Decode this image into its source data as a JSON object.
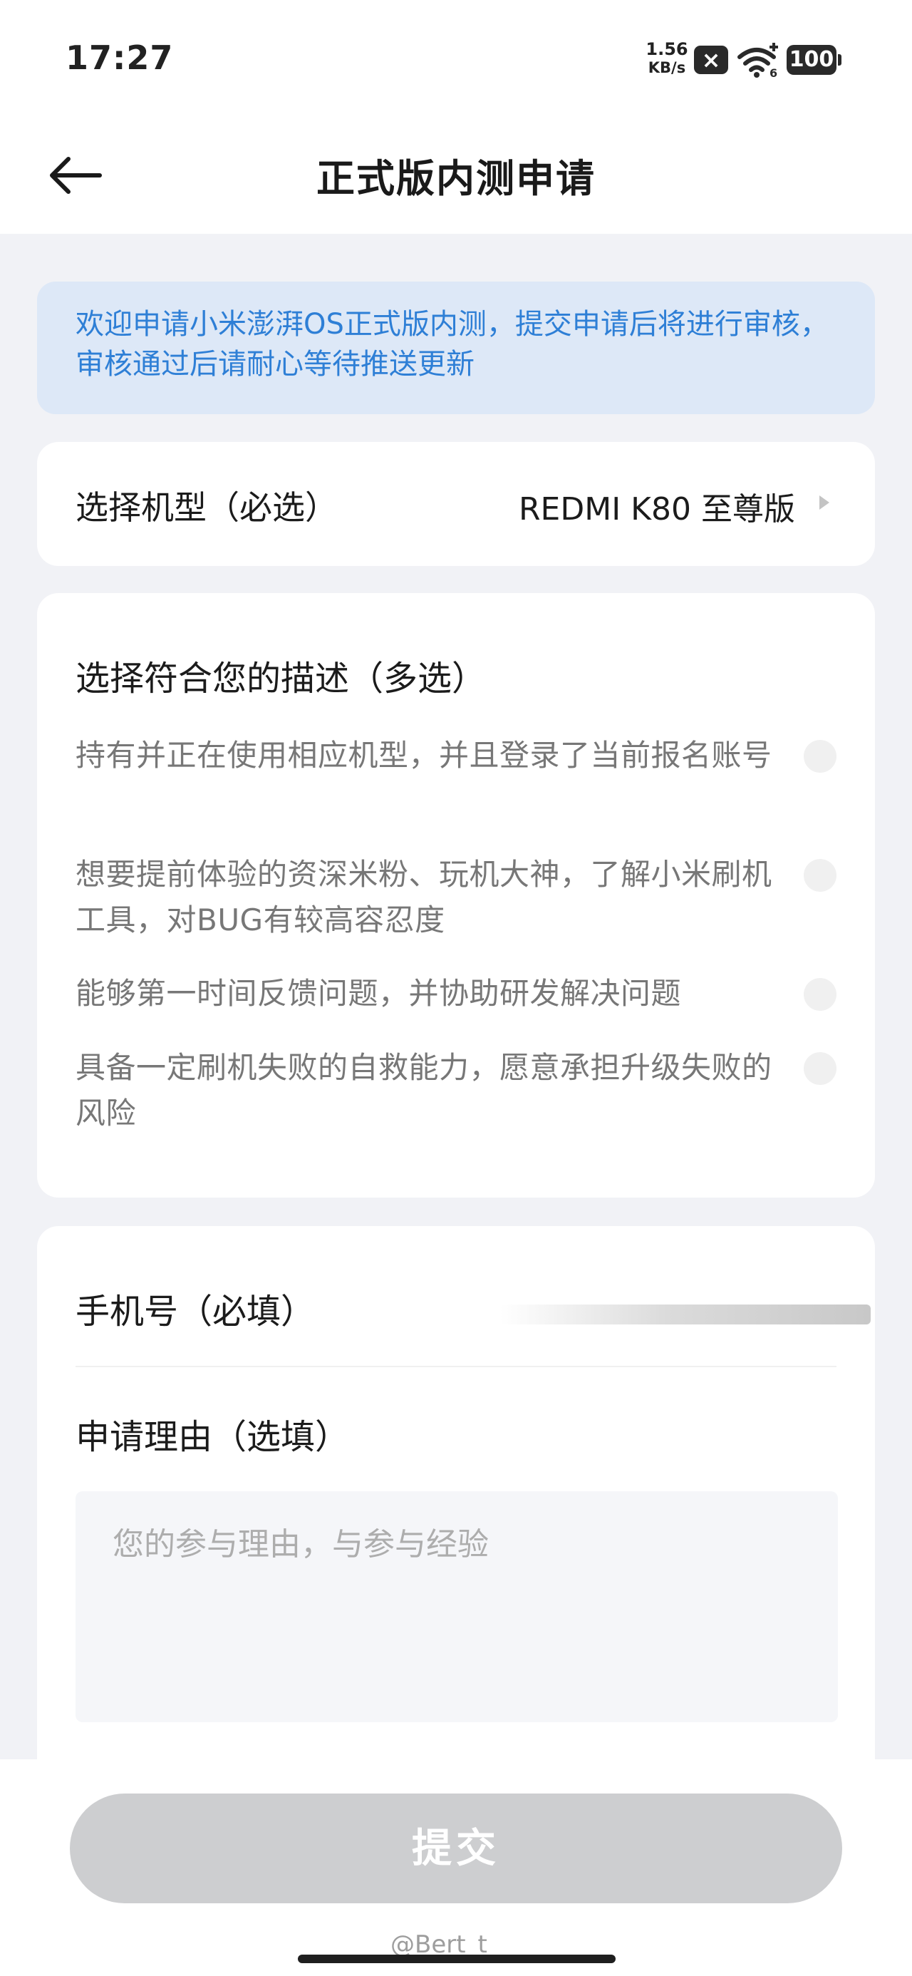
{
  "status_bar": {
    "time": "17:27",
    "net_speed_value": "1.56",
    "net_speed_unit": "KB/s",
    "sim_icon": "sim-disabled-icon",
    "wifi_icon": "wifi-6-icon",
    "battery": "100"
  },
  "header": {
    "title": "正式版内测申请",
    "back_icon": "arrow-left-icon"
  },
  "notice": {
    "text": "欢迎申请小米澎湃OS正式版内测，提交申请后将进行审核，审核通过后请耐心等待推送更新"
  },
  "model_select": {
    "label": "选择机型（必选）",
    "value": "REDMI K80 至尊版",
    "arrow_icon": "chevron-right-icon"
  },
  "description": {
    "title": "选择符合您的描述（多选）",
    "options": [
      {
        "text": "持有并正在使用相应机型，并且登录了当前报名账号",
        "checked": false
      },
      {
        "text": "想要提前体验的资深米粉、玩机大神，了解小米刷机工具，对BUG有较高容忍度",
        "checked": false
      },
      {
        "text": "能够第一时间反馈问题，并协助研发解决问题",
        "checked": false
      },
      {
        "text": "具备一定刷机失败的自救能力，愿意承担升级失败的风险",
        "checked": false
      }
    ]
  },
  "form": {
    "phone_label": "手机号（必填）",
    "reason_label": "申请理由（选填）",
    "reason_placeholder": "您的参与理由，与参与经验"
  },
  "submit": {
    "label": "提交"
  },
  "watermark": "@Bert_t",
  "colors": {
    "accent_text": "#2e7fd6",
    "notice_bg": "#dde8f7",
    "page_bg": "#f1f2f6",
    "submit_disabled": "#cdced0"
  }
}
